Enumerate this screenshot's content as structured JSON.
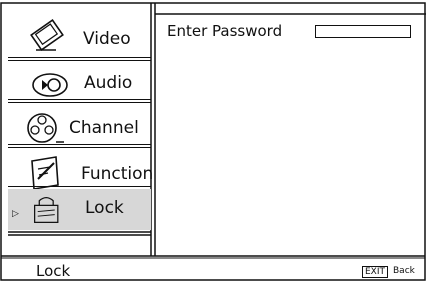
{
  "menu": {
    "items": [
      {
        "label": "Video",
        "icon": "video-icon"
      },
      {
        "label": "Audio",
        "icon": "audio-icon"
      },
      {
        "label": "Channel",
        "icon": "channel-icon"
      },
      {
        "label": "Function",
        "icon": "function-icon"
      },
      {
        "label": "Lock",
        "icon": "lock-icon"
      }
    ],
    "selected": "Lock"
  },
  "panel": {
    "password_label": "Enter Password",
    "password_value": ""
  },
  "footer": {
    "title": "Lock",
    "exit_key": "EXIT",
    "exit_label": "Back"
  },
  "colors": {
    "selected_bg": "#d7d7d7",
    "line": "#111111"
  }
}
